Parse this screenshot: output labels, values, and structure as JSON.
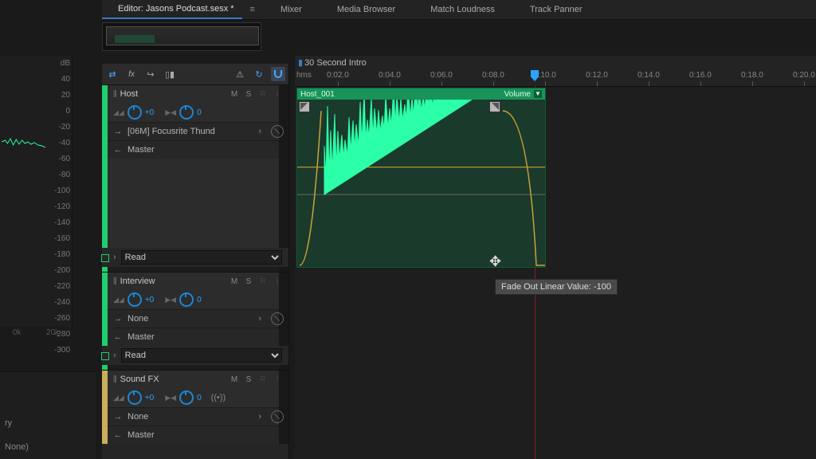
{
  "header": {
    "panel_prefix": "Editor:",
    "doc_title": "Jasons Podcast.sesx *",
    "tabs": [
      "Mixer",
      "Media Browser",
      "Match Loudness",
      "Track Panner"
    ]
  },
  "db_scale": [
    "dB",
    "40",
    "20",
    "0",
    "-20",
    "-40",
    "-60",
    "-80",
    "-100",
    "-120",
    "-140",
    "-160",
    "-180",
    "-200",
    "-220",
    "-240",
    "-260",
    "-280",
    "-300"
  ],
  "freq_labels": [
    "0k",
    "20k"
  ],
  "tracks": [
    {
      "name": "Host",
      "msr": {
        "m": "M",
        "s": "S",
        "r": "R",
        "i": "I"
      },
      "vol": "+0",
      "pan": "0",
      "input": "[06M] Focusrite Thund",
      "output": "Master",
      "automation": "Read"
    },
    {
      "name": "Interview",
      "msr": {
        "m": "M",
        "s": "S",
        "r": "R",
        "i": "I"
      },
      "vol": "+0",
      "pan": "0",
      "input": "None",
      "output": "Master",
      "automation": "Read"
    },
    {
      "name": "Sound FX",
      "msr": {
        "m": "M",
        "s": "S",
        "r": "R",
        "i": "I"
      },
      "vol": "+0",
      "pan": "0",
      "input": "None",
      "output": "Master"
    }
  ],
  "timeline": {
    "section": "30 Second Intro",
    "ruler_unit": "hms",
    "ticks": [
      "0:02.0",
      "0:04.0",
      "0:06.0",
      "0:08.0",
      "0:10.0",
      "0:12.0",
      "0:14.0",
      "0:16.0",
      "0:18.0",
      "0:20.0"
    ],
    "clip": {
      "name": "Host_001",
      "volume_label": "Volume"
    },
    "tooltip": "Fade Out Linear Value: -100"
  },
  "bottom_left": {
    "line1": "ry",
    "line2": "None)"
  }
}
